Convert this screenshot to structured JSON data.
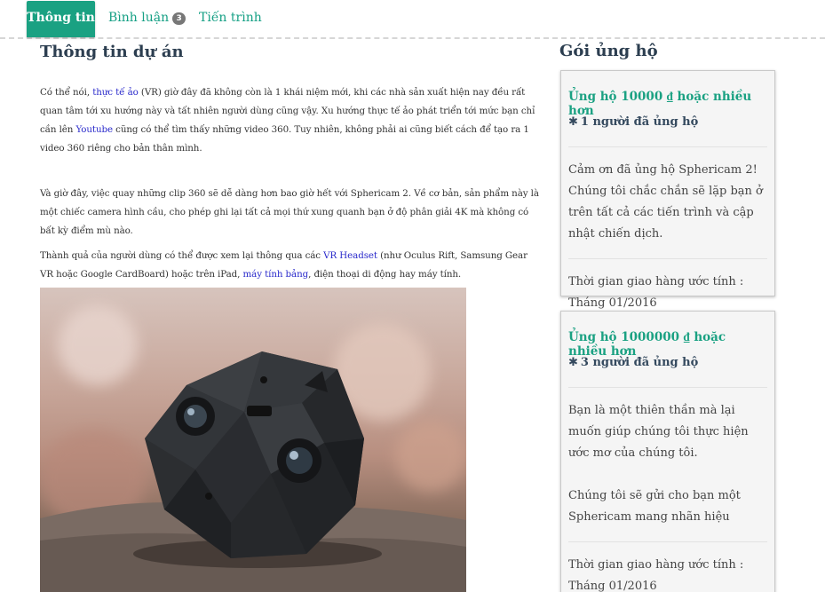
{
  "tabs": {
    "info": "Thông tin",
    "comments": "Bình luận",
    "comments_count": "3",
    "progress": "Tiến trình"
  },
  "main": {
    "title": "Thông tin dự án",
    "p1": {
      "t1": "Có thể nói, ",
      "link1": "thực tế ảo",
      "t2": " (VR) giờ đây đã không còn là 1 khái niệm mới, khi các nhà sản xuất hiện nay đều rất quan tâm tới xu hướng này và tất nhiên người dùng cũng vậy. Xu hướng thực tế ảo phát triển tới mức bạn chỉ cần lên ",
      "link2": "Youtube",
      "t3": " cũng có thể tìm thấy những video 360. Tuy nhiên, không phải ai cũng biết cách để tạo ra 1 video 360 riêng cho bản thân mình."
    },
    "p2": "Và giờ đây, việc quay những clip 360 sẽ dễ dàng hơn bao giờ hết với Sphericam 2. Về cơ bản, sản phẩm này là một chiếc camera hình cầu, cho phép ghi lại tất cả mọi thứ xung quanh bạn ở độ phân giải 4K mà không có bất kỳ điểm mù nào.",
    "p3": {
      "t1": "Thành quả của người dùng có thể được xem lại thông qua các ",
      "link1": "VR Headset",
      "t2": " (như Oculus Rift, Samsung Gear VR hoặc Google CardBoard) hoặc trên iPad, ",
      "link2": "máy tính bảng",
      "t3": ", điện thoại di động hay máy tính."
    }
  },
  "sidebar": {
    "title": "Gói ủng hộ",
    "star_icon": "✱",
    "cards": [
      {
        "amount": "Ủng hộ 10000 ₫ hoặc nhiều hơn",
        "backers": "1 người đã ủng hộ",
        "desc": "Cảm ơn đã ủng hộ Sphericam 2! Chúng tôi chắc chắn sẽ lặp bạn ở trên tất cả các tiến trình và cập nhật chiến dịch.",
        "delivery_label": "Thời gian giao hàng ước tính :",
        "delivery_value": "Tháng 01/2016"
      },
      {
        "amount": "Ủng hộ 1000000 ₫ hoặc nhiều hơn",
        "backers": "3 người đã ủng hộ",
        "desc1": "Bạn là một thiên thần mà lại muốn giúp chúng tôi thực hiện ước mơ của chúng tôi.",
        "desc2": "Chúng tôi sẽ gửi cho bạn một Sphericam mang nhãn hiệu",
        "delivery_label": "Thời gian giao hàng ước tính :",
        "delivery_value": "Tháng 01/2016"
      }
    ]
  },
  "colors": {
    "accent": "#1aa182",
    "link": "#2a2acb",
    "heading": "#2c3e50"
  }
}
